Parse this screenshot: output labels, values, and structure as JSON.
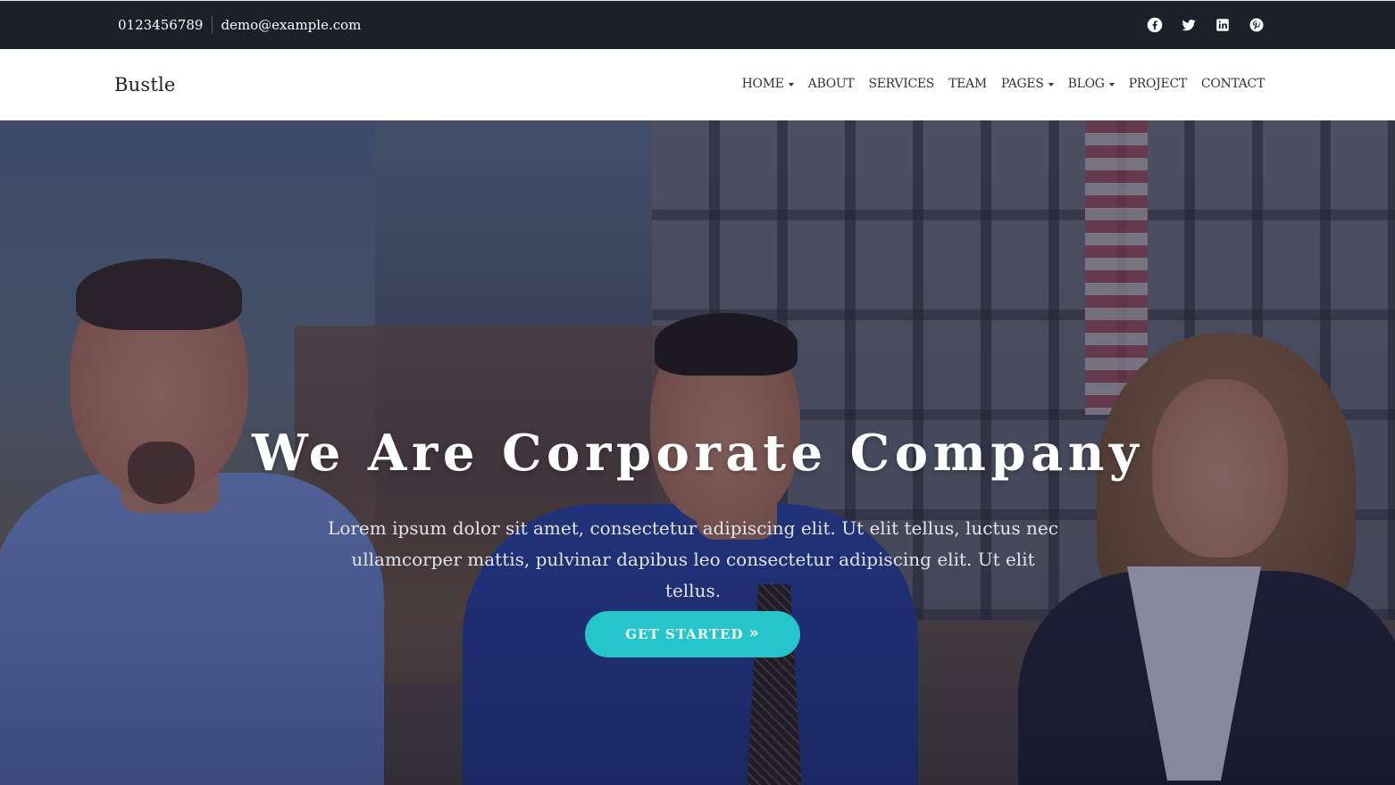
{
  "topbar": {
    "phone": "0123456789",
    "email": "demo@example.com",
    "social": [
      {
        "name": "facebook-icon"
      },
      {
        "name": "twitter-icon"
      },
      {
        "name": "linkedin-icon"
      },
      {
        "name": "pinterest-icon"
      }
    ]
  },
  "navbar": {
    "brand": "Bustle",
    "menu": [
      {
        "label": "HOME",
        "dropdown": true
      },
      {
        "label": "ABOUT",
        "dropdown": false
      },
      {
        "label": "SERVICES",
        "dropdown": false
      },
      {
        "label": "TEAM",
        "dropdown": false
      },
      {
        "label": "PAGES",
        "dropdown": true
      },
      {
        "label": "BLOG",
        "dropdown": true
      },
      {
        "label": "PROJECT",
        "dropdown": false
      },
      {
        "label": "CONTACT",
        "dropdown": false
      }
    ]
  },
  "hero": {
    "title": "We Are Corporate Company",
    "subtitle": "Lorem ipsum dolor sit amet, consectetur adipiscing elit. Ut elit tellus, luctus nec ullamcorper mattis, pulvinar dapibus leo consectetur adipiscing elit. Ut elit tellus.",
    "cta_label": "GET STARTED",
    "cta_icon": "double-chevron-right-icon"
  },
  "colors": {
    "topbar_bg": "#1d2029",
    "accent": "#25c5cc",
    "nav_text": "#333333"
  }
}
